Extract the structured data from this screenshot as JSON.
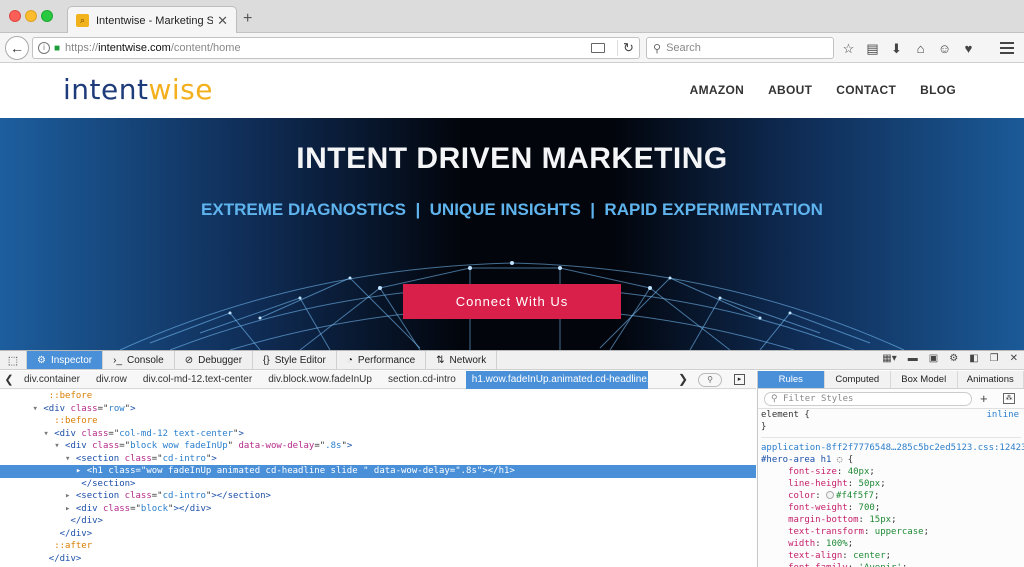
{
  "browser": {
    "tab_title": "Intentwise - Marketing Stra...",
    "url_prefix": "https://",
    "url_host": "intentwise.com",
    "url_path": "/content/home",
    "search_placeholder": "Search",
    "colors": {
      "titlebar": "#dcdcdc",
      "navbar": "#f5f5f5"
    },
    "toolbar_icons": [
      "bookmark-star-icon",
      "reading-list-icon",
      "download-icon",
      "home-icon",
      "chat-icon",
      "pocket-icon"
    ]
  },
  "site": {
    "logo_part1": "intent",
    "logo_part2": "wise",
    "nav": [
      "AMAZON",
      "ABOUT",
      "CONTACT",
      "BLOG"
    ],
    "hero_title": "INTENT DRIVEN MARKETING",
    "hero_sub": "EXTREME DIAGNOSTICS  |  UNIQUE INSIGHTS  |  RAPID EXPERIMENTATION",
    "cta_label": "Connect With Us",
    "colors": {
      "logo_primary": "#1f3c7a",
      "logo_accent": "#f3b01c",
      "hero_sub": "#5fb4ee",
      "cta": "#d8204a"
    }
  },
  "devtools": {
    "tabs": [
      "Inspector",
      "Console",
      "Debugger",
      "Style Editor",
      "Performance",
      "Network"
    ],
    "active_tab": "Inspector",
    "breadcrumbs": [
      "div.container",
      "div.row",
      "div.col-md-12.text-center",
      "div.block.wow.fadeInUp",
      "section.cd-intro",
      "h1.wow.fadeInUp.animated.cd-headline.sli..."
    ],
    "markup": [
      {
        "indent": "         ",
        "type": "pseudo",
        "text": "::before"
      },
      {
        "indent": "      ",
        "twisty": "▾",
        "open": "<div",
        "attrs": [
          [
            "class",
            "row"
          ]
        ],
        "close": ">"
      },
      {
        "indent": "          ",
        "type": "pseudo",
        "text": "::before"
      },
      {
        "indent": "        ",
        "twisty": "▾",
        "open": "<div",
        "attrs": [
          [
            "class",
            "col-md-12 text-center"
          ]
        ],
        "close": ">"
      },
      {
        "indent": "          ",
        "twisty": "▾",
        "open": "<div",
        "attrs": [
          [
            "class",
            "block wow fadeInUp"
          ],
          [
            "data-wow-delay",
            ".8s"
          ]
        ],
        "close": ">"
      },
      {
        "indent": "            ",
        "twisty": "▾",
        "open": "<section",
        "attrs": [
          [
            "class",
            "cd-intro"
          ]
        ],
        "close": ">"
      },
      {
        "indent": "              ",
        "twisty": "▸",
        "open": "<h1",
        "attrs": [
          [
            "class",
            "wow fadeInUp animated cd-headline slide "
          ],
          [
            "data-wow-delay",
            ".8s"
          ]
        ],
        "close": "></h1>",
        "selected": true
      },
      {
        "indent": "               ",
        "open": "</section>",
        "attrs": [],
        "close": ""
      },
      {
        "indent": "            ",
        "twisty": "▸",
        "open": "<section",
        "attrs": [
          [
            "class",
            "cd-intro"
          ]
        ],
        "close": "></section>"
      },
      {
        "indent": "            ",
        "twisty": "▸",
        "open": "<div",
        "attrs": [
          [
            "class",
            "block"
          ]
        ],
        "close": "></div>"
      },
      {
        "indent": "             ",
        "open": "</div>",
        "attrs": [],
        "close": ""
      },
      {
        "indent": "           ",
        "open": "</div>",
        "attrs": [],
        "close": ""
      },
      {
        "indent": "          ",
        "type": "pseudo",
        "text": "::after"
      },
      {
        "indent": "         ",
        "open": "</div>",
        "attrs": [],
        "close": ""
      }
    ],
    "side_tabs": [
      "Rules",
      "Computed",
      "Box Model",
      "Animations"
    ],
    "active_side_tab": "Rules",
    "filter_placeholder": "Filter Styles",
    "rules": {
      "element_selector": "element {",
      "element_close": "}",
      "inline_label": "inline",
      "source": "application-8ff2f7776548…285c5bc2ed5123.css:12423",
      "selector": "#hero-area h1",
      "declarations": [
        {
          "name": "font-size",
          "value": "40px"
        },
        {
          "name": "line-height",
          "value": "50px"
        },
        {
          "name": "color",
          "value": "#f4f5f7",
          "swatch": true
        },
        {
          "name": "font-weight",
          "value": "700"
        },
        {
          "name": "margin-bottom",
          "value": "15px"
        },
        {
          "name": "text-transform",
          "value": "uppercase"
        },
        {
          "name": "width",
          "value": "100%"
        },
        {
          "name": "text-align",
          "value": "center"
        },
        {
          "name": "font-family",
          "value": "'Avenir'"
        }
      ]
    },
    "colors": {
      "accent": "#4a90d9",
      "pseudo": "#d97e00",
      "tag": "#1b4fa8",
      "attr": "#b52b8a",
      "value": "#2a7ecc"
    }
  }
}
